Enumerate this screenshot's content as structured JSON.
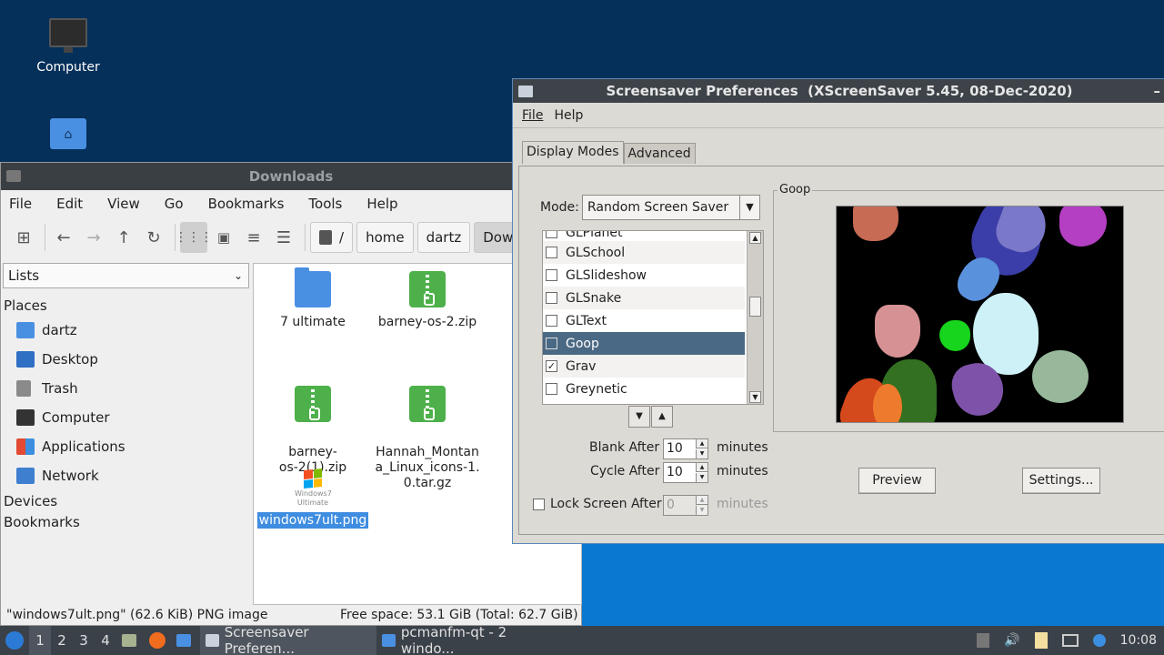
{
  "desktop": {
    "icons": [
      {
        "label": "Computer",
        "icon": "monitor-icon"
      },
      {
        "label": "",
        "icon": "home-folder-icon"
      }
    ]
  },
  "file_manager": {
    "title": "Downloads",
    "menu": [
      "File",
      "Edit",
      "View",
      "Go",
      "Bookmarks",
      "Tools",
      "Help"
    ],
    "toolbar": {
      "icons": [
        "new-tab-icon",
        "back-icon",
        "forward-icon",
        "up-icon",
        "reload-icon",
        "icon-view-icon",
        "thumbnail-view-icon",
        "compact-view-icon",
        "detailed-list-icon"
      ]
    },
    "breadcrumb": {
      "root": "/",
      "items": [
        "home",
        "dartz",
        "Downlo"
      ]
    },
    "side_panel_mode": "Lists",
    "places_header": "Places",
    "places": [
      {
        "label": "dartz",
        "icon": "home-folder-icon",
        "color": "#4a90e2"
      },
      {
        "label": "Desktop",
        "icon": "desktop-icon",
        "color": "#2f6fc4"
      },
      {
        "label": "Trash",
        "icon": "trash-icon",
        "color": "#8a8a8a"
      },
      {
        "label": "Computer",
        "icon": "computer-icon",
        "color": "#333333"
      },
      {
        "label": "Applications",
        "icon": "applications-icon",
        "color": "#e24a33"
      },
      {
        "label": "Network",
        "icon": "network-icon",
        "color": "#3f7fd0"
      }
    ],
    "devices_header": "Devices",
    "bookmarks_header": "Bookmarks",
    "files": [
      {
        "name": "7 ultimate",
        "type": "folder"
      },
      {
        "name": "barney-os-2.zip",
        "type": "zip"
      },
      {
        "name": "barney-\nos-2(1).zip",
        "type": "zip"
      },
      {
        "name": "Hannah_Montan\na_Linux_icons-1.\n0.tar.gz",
        "type": "zip"
      },
      {
        "name": "windows7ult.png",
        "type": "image",
        "selected": true,
        "thumb_text": "Windows7\nUltimate"
      }
    ],
    "status_left": "\"windows7ult.png\" (62.6 KiB) PNG image",
    "status_right": "Free space: 53.1 GiB (Total: 62.7 GiB)"
  },
  "screensaver": {
    "title": "Screensaver Preferences  (XScreenSaver 5.45, 08-Dec-2020)",
    "minimize": "–",
    "menu": [
      "File",
      "Help"
    ],
    "tabs": [
      "Display Modes",
      "Advanced"
    ],
    "mode_label": "Mode:",
    "mode_value": "Random Screen Saver",
    "list": [
      {
        "label": "GLSchool",
        "checked": false
      },
      {
        "label": "GLSlideshow",
        "checked": false
      },
      {
        "label": "GLSnake",
        "checked": false
      },
      {
        "label": "GLText",
        "checked": false
      },
      {
        "label": "Goop",
        "checked": false,
        "selected": true
      },
      {
        "label": "Grav",
        "checked": true
      },
      {
        "label": "Greynetic",
        "checked": false
      }
    ],
    "preview_frame_label": "Goop",
    "blank_after": {
      "label": "Blank After",
      "value": "10",
      "unit": "minutes"
    },
    "cycle_after": {
      "label": "Cycle After",
      "value": "10",
      "unit": "minutes"
    },
    "lock_after": {
      "label": "Lock Screen After",
      "value": "0",
      "unit": "minutes",
      "enabled": false
    },
    "preview_button": "Preview",
    "settings_button": "Settings..."
  },
  "taskbar": {
    "workspaces": [
      "1",
      "2",
      "3",
      "4"
    ],
    "current_workspace": "1",
    "apps": [
      {
        "label": "Screensaver Preferen...",
        "active": true
      },
      {
        "label": "pcmanfm-qt - 2 windo...",
        "active": false
      }
    ],
    "clock": "10:08"
  }
}
